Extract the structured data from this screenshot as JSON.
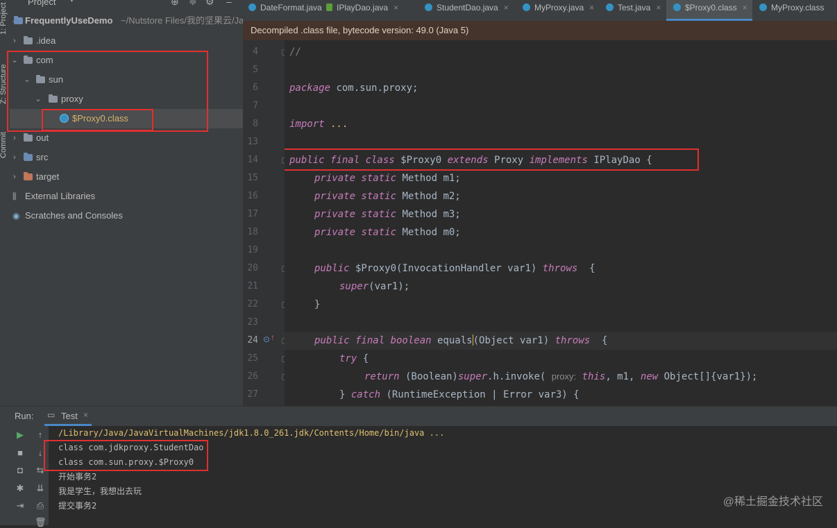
{
  "sidebar": {
    "project_tab_label": "1: Project",
    "structure_tab_label": "Z: Structure",
    "commit_tab_label": "Commit"
  },
  "project_panel": {
    "header_label": "Project",
    "root_name": "FrequentlyUseDemo",
    "root_path": "~/Nutstore Files/我的坚果云/Ja",
    "items": [
      {
        "label": ".idea"
      },
      {
        "label": "com"
      },
      {
        "label": "sun"
      },
      {
        "label": "proxy"
      },
      {
        "label": "$Proxy0.class"
      },
      {
        "label": "out"
      },
      {
        "label": "src"
      },
      {
        "label": "target"
      },
      {
        "label": "External Libraries"
      },
      {
        "label": "Scratches and Consoles"
      }
    ]
  },
  "tabs": [
    {
      "label": "DateFormat.java",
      "icon": "class-icon"
    },
    {
      "label": "IPlayDao.java",
      "icon": "interface-icon"
    },
    {
      "label": "StudentDao.java",
      "icon": "class-icon"
    },
    {
      "label": "MyProxy.java",
      "icon": "class-icon"
    },
    {
      "label": "Test.java",
      "icon": "class-icon"
    },
    {
      "label": "$Proxy0.class",
      "icon": "class-icon",
      "active": true
    },
    {
      "label": "MyProxy.class",
      "icon": "class-icon"
    }
  ],
  "editor": {
    "banner": "Decompiled .class file, bytecode version: 49.0 (Java 5)",
    "current_line": "24",
    "line_numbers": [
      "4",
      "5",
      "6",
      "7",
      "8",
      "13",
      "14",
      "15",
      "16",
      "17",
      "18",
      "19",
      "20",
      "21",
      "22",
      "23",
      "24",
      "25",
      "26",
      "27"
    ],
    "code": {
      "l4": "//",
      "l6_kw": "package",
      "l6_rest": " com.sun.proxy;",
      "l8_kw": "import",
      "l8_rest": " ...",
      "l14_kw1": "public final class",
      "l14_name": " $Proxy0 ",
      "l14_kw2": "extends",
      "l14_super": " Proxy ",
      "l14_kw3": "implements",
      "l14_iface": " IPlayDao {",
      "l15_kw": "private static",
      "l15_rest": " Method m1;",
      "l16_kw": "private static",
      "l16_rest": " Method m2;",
      "l17_kw": "private static",
      "l17_rest": " Method m3;",
      "l18_kw": "private static",
      "l18_rest": " Method m0;",
      "l20_kw": "public",
      "l20_rest": " $Proxy0(InvocationHandler var1) ",
      "l20_kw2": "throws",
      "l20_end": "  {",
      "l21_kw": "super",
      "l21_rest": "(var1);",
      "l22": "}",
      "l24_kw": "public final boolean",
      "l24_rest_a": " equals",
      "l24_rest_b": "(Object var1) ",
      "l24_kw2": "throws",
      "l24_end": "  {",
      "l25_kw": "try",
      "l25_rest": " {",
      "l26_kw": "return",
      "l26_rest_a": " (Boolean)",
      "l26_kw2": "super",
      "l26_rest_b": ".h.invoke( ",
      "l26_hint": "proxy:",
      "l26_kw3": " this",
      "l26_rest_c": ", m1, ",
      "l26_kw4": "new",
      "l26_rest_d": " Object[]{var1});",
      "l27_a": "} ",
      "l27_kw": "catch",
      "l27_rest": " (RuntimeException | Error var3) {"
    }
  },
  "run_panel": {
    "label": "Run:",
    "tab_label": "Test",
    "output": [
      "/Library/Java/JavaVirtualMachines/jdk1.8.0_261.jdk/Contents/Home/bin/java ...",
      "class com.jdkproxy.StudentDao",
      "class com.sun.proxy.$Proxy0",
      "开始事务2",
      "我是学生，我想出去玩",
      "提交事务2"
    ]
  },
  "watermark": "@稀土掘金技术社区",
  "colors": {
    "keyword": "#c77dbb",
    "highlight_box": "#e03030",
    "banner_bg": "#45342b",
    "run_path": "#e0c070"
  }
}
